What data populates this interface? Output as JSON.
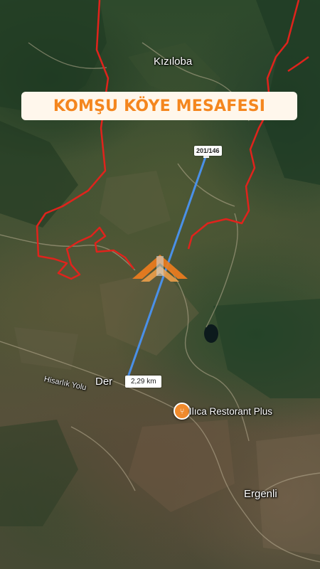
{
  "title": "KOMŞU KÖYE MESAFESI",
  "places": {
    "village_north": "Kızıloba",
    "village_southeast": "Ergenli",
    "village_west": "Der",
    "road": "Hisarlık Yolu",
    "restaurant": "Ilıca Restorant Plus"
  },
  "measure": {
    "parcel_tag": "201/146",
    "distance": "2,29 km",
    "line_color": "#4a90e8"
  },
  "colors": {
    "boundary": "#e0231c",
    "title_text": "#f4861e",
    "title_bg": "#fff7ec",
    "pin": "#f08a2c"
  },
  "icons": {
    "restaurant": "fork-knife-icon",
    "logo": "roof-logo"
  }
}
